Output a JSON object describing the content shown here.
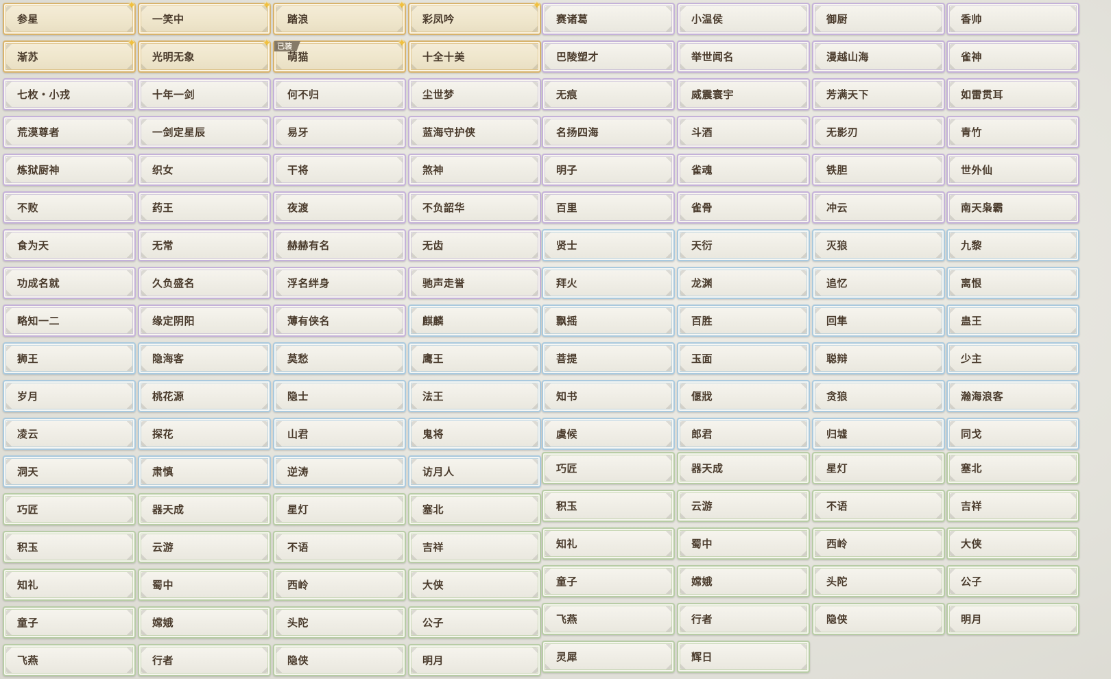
{
  "equipped_badge": "已装",
  "columns": [
    [
      {
        "label": "参星",
        "tier": "gold"
      },
      {
        "label": "渐苏",
        "tier": "gold"
      },
      {
        "label": "七枚・小戎",
        "tier": "purple"
      },
      {
        "label": "荒漠尊者",
        "tier": "purple"
      },
      {
        "label": "炼狱厨神",
        "tier": "purple"
      },
      {
        "label": "不败",
        "tier": "purple"
      },
      {
        "label": "食为天",
        "tier": "purple"
      },
      {
        "label": "功成名就",
        "tier": "purple"
      },
      {
        "label": "略知一二",
        "tier": "purple"
      },
      {
        "label": "狮王",
        "tier": "blue"
      },
      {
        "label": "岁月",
        "tier": "blue"
      },
      {
        "label": "凌云",
        "tier": "blue"
      },
      {
        "label": "洞天",
        "tier": "blue"
      },
      {
        "label": "巧匠",
        "tier": "green"
      },
      {
        "label": "积玉",
        "tier": "green"
      },
      {
        "label": "知礼",
        "tier": "green"
      },
      {
        "label": "童子",
        "tier": "green"
      },
      {
        "label": "飞燕",
        "tier": "green"
      }
    ],
    [
      {
        "label": "一笑中",
        "tier": "gold"
      },
      {
        "label": "光明无象",
        "tier": "gold"
      },
      {
        "label": "十年一剑",
        "tier": "purple"
      },
      {
        "label": "一剑定星辰",
        "tier": "purple"
      },
      {
        "label": "织女",
        "tier": "purple"
      },
      {
        "label": "药王",
        "tier": "purple"
      },
      {
        "label": "无常",
        "tier": "purple"
      },
      {
        "label": "久负盛名",
        "tier": "purple"
      },
      {
        "label": "缘定阴阳",
        "tier": "purple"
      },
      {
        "label": "隐海客",
        "tier": "blue"
      },
      {
        "label": "桃花源",
        "tier": "blue"
      },
      {
        "label": "探花",
        "tier": "blue"
      },
      {
        "label": "肃慎",
        "tier": "blue"
      },
      {
        "label": "器天成",
        "tier": "green"
      },
      {
        "label": "云游",
        "tier": "green"
      },
      {
        "label": "蜀中",
        "tier": "green"
      },
      {
        "label": "嫦娥",
        "tier": "green"
      },
      {
        "label": "行者",
        "tier": "green"
      }
    ],
    [
      {
        "label": "踏浪",
        "tier": "gold"
      },
      {
        "label": "萌猫",
        "tier": "gold",
        "equipped": true
      },
      {
        "label": "何不归",
        "tier": "purple"
      },
      {
        "label": "易牙",
        "tier": "purple"
      },
      {
        "label": "干将",
        "tier": "purple"
      },
      {
        "label": "夜渡",
        "tier": "purple"
      },
      {
        "label": "赫赫有名",
        "tier": "purple"
      },
      {
        "label": "浮名绊身",
        "tier": "purple"
      },
      {
        "label": "薄有侠名",
        "tier": "purple"
      },
      {
        "label": "莫愁",
        "tier": "blue"
      },
      {
        "label": "隐士",
        "tier": "blue"
      },
      {
        "label": "山君",
        "tier": "blue"
      },
      {
        "label": "逆涛",
        "tier": "blue"
      },
      {
        "label": "星灯",
        "tier": "green"
      },
      {
        "label": "不语",
        "tier": "green"
      },
      {
        "label": "西岭",
        "tier": "green"
      },
      {
        "label": "头陀",
        "tier": "green"
      },
      {
        "label": "隐侠",
        "tier": "green"
      }
    ],
    [
      {
        "label": "彩凤吟",
        "tier": "gold"
      },
      {
        "label": "十全十美",
        "tier": "gold",
        "star": false
      },
      {
        "label": "尘世梦",
        "tier": "purple"
      },
      {
        "label": "蓝海守护侠",
        "tier": "purple"
      },
      {
        "label": "煞神",
        "tier": "purple"
      },
      {
        "label": "不负韶华",
        "tier": "purple"
      },
      {
        "label": "无齿",
        "tier": "purple"
      },
      {
        "label": "驰声走誉",
        "tier": "purple"
      },
      {
        "label": "麒麟",
        "tier": "blue"
      },
      {
        "label": "鹰王",
        "tier": "blue"
      },
      {
        "label": "法王",
        "tier": "blue"
      },
      {
        "label": "鬼将",
        "tier": "blue"
      },
      {
        "label": "访月人",
        "tier": "blue"
      },
      {
        "label": "塞北",
        "tier": "green"
      },
      {
        "label": "吉祥",
        "tier": "green"
      },
      {
        "label": "大侠",
        "tier": "green"
      },
      {
        "label": "公子",
        "tier": "green"
      },
      {
        "label": "明月",
        "tier": "green"
      }
    ],
    [
      {
        "label": "赛诸葛",
        "tier": "purple"
      },
      {
        "label": "巴陵塑才",
        "tier": "purple"
      },
      {
        "label": "无痕",
        "tier": "purple"
      },
      {
        "label": "名扬四海",
        "tier": "purple"
      },
      {
        "label": "明子",
        "tier": "purple"
      },
      {
        "label": "百里",
        "tier": "purple"
      },
      {
        "label": "贤士",
        "tier": "blue"
      },
      {
        "label": "拜火",
        "tier": "blue"
      },
      {
        "label": "飘摇",
        "tier": "blue"
      },
      {
        "label": "菩提",
        "tier": "blue"
      },
      {
        "label": "知书",
        "tier": "blue"
      },
      {
        "label": "虞候",
        "tier": "blue"
      },
      {
        "label": "巧匠",
        "tier": "green"
      },
      {
        "label": "积玉",
        "tier": "green"
      },
      {
        "label": "知礼",
        "tier": "green"
      },
      {
        "label": "童子",
        "tier": "green"
      },
      {
        "label": "飞燕",
        "tier": "green"
      },
      {
        "label": "灵犀",
        "tier": "green"
      }
    ],
    [
      {
        "label": "小温侯",
        "tier": "purple"
      },
      {
        "label": "举世闻名",
        "tier": "purple"
      },
      {
        "label": "威震寰宇",
        "tier": "purple"
      },
      {
        "label": "斗酒",
        "tier": "purple"
      },
      {
        "label": "雀魂",
        "tier": "purple"
      },
      {
        "label": "雀骨",
        "tier": "purple"
      },
      {
        "label": "天衍",
        "tier": "blue"
      },
      {
        "label": "龙渊",
        "tier": "blue"
      },
      {
        "label": "百胜",
        "tier": "blue"
      },
      {
        "label": "玉面",
        "tier": "blue"
      },
      {
        "label": "偃戕",
        "tier": "blue"
      },
      {
        "label": "郎君",
        "tier": "blue"
      },
      {
        "label": "器天成",
        "tier": "green"
      },
      {
        "label": "云游",
        "tier": "green"
      },
      {
        "label": "蜀中",
        "tier": "green"
      },
      {
        "label": "嫦娥",
        "tier": "green"
      },
      {
        "label": "行者",
        "tier": "green"
      },
      {
        "label": "辉日",
        "tier": "green"
      }
    ],
    [
      {
        "label": "御厨",
        "tier": "purple"
      },
      {
        "label": "漫越山海",
        "tier": "purple"
      },
      {
        "label": "芳满天下",
        "tier": "purple"
      },
      {
        "label": "无影刃",
        "tier": "purple"
      },
      {
        "label": "铁胆",
        "tier": "purple"
      },
      {
        "label": "冲云",
        "tier": "purple"
      },
      {
        "label": "灭狼",
        "tier": "blue"
      },
      {
        "label": "追忆",
        "tier": "blue"
      },
      {
        "label": "回隼",
        "tier": "blue"
      },
      {
        "label": "聪辩",
        "tier": "blue"
      },
      {
        "label": "贪狼",
        "tier": "blue"
      },
      {
        "label": "归墟",
        "tier": "blue"
      },
      {
        "label": "星灯",
        "tier": "green"
      },
      {
        "label": "不语",
        "tier": "green"
      },
      {
        "label": "西岭",
        "tier": "green"
      },
      {
        "label": "头陀",
        "tier": "green"
      },
      {
        "label": "隐侠",
        "tier": "green"
      }
    ],
    [
      {
        "label": "香帅",
        "tier": "purple"
      },
      {
        "label": "雀神",
        "tier": "purple"
      },
      {
        "label": "如雷贯耳",
        "tier": "purple"
      },
      {
        "label": "青竹",
        "tier": "purple"
      },
      {
        "label": "世外仙",
        "tier": "purple"
      },
      {
        "label": "南天枭霸",
        "tier": "purple"
      },
      {
        "label": "九黎",
        "tier": "blue"
      },
      {
        "label": "离恨",
        "tier": "blue"
      },
      {
        "label": "蛊王",
        "tier": "blue"
      },
      {
        "label": "少主",
        "tier": "blue"
      },
      {
        "label": "瀚海浪客",
        "tier": "blue"
      },
      {
        "label": "同戈",
        "tier": "blue"
      },
      {
        "label": "塞北",
        "tier": "green"
      },
      {
        "label": "吉祥",
        "tier": "green"
      },
      {
        "label": "大侠",
        "tier": "green"
      },
      {
        "label": "公子",
        "tier": "green"
      },
      {
        "label": "明月",
        "tier": "green"
      }
    ]
  ]
}
